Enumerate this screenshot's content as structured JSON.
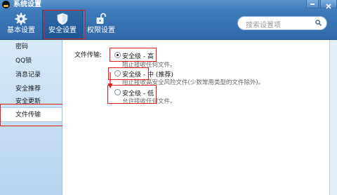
{
  "window": {
    "title": "系统设置"
  },
  "toolbar": {
    "items": [
      {
        "label": "基本设置",
        "icon": "gear-icon"
      },
      {
        "label": "安全设置",
        "icon": "shield-icon"
      },
      {
        "label": "权限设置",
        "icon": "unlock-icon"
      }
    ]
  },
  "search": {
    "placeholder": "搜索设置项"
  },
  "sidebar": {
    "items": [
      {
        "label": "密码"
      },
      {
        "label": "QQ锁"
      },
      {
        "label": "消息记录"
      },
      {
        "label": "安全推荐"
      },
      {
        "label": "安全更新"
      },
      {
        "label": "文件传输"
      }
    ],
    "selected": "文件传输"
  },
  "file_transfer": {
    "label": "文件传输:",
    "options": [
      {
        "label": "安全级 - 高",
        "desc": "阻止接收任何文件。",
        "selected": true
      },
      {
        "label": "安全级 - 中 (推荐)",
        "desc": "阻止接收高安全风险文件(少数常用类型的文件除外)。",
        "selected": false
      },
      {
        "label": "安全级 - 低",
        "desc": "允许接收任何文件。",
        "selected": false
      }
    ]
  },
  "colors": {
    "annotation": "#e02020",
    "toolbar": "#3e7cbb"
  }
}
